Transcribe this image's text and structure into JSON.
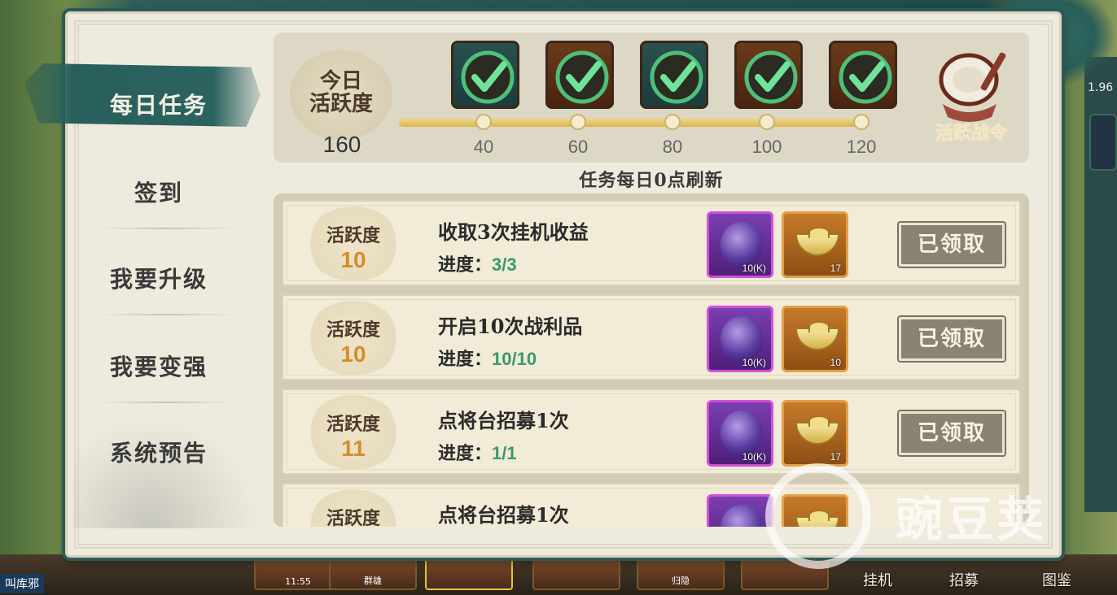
{
  "nav": {
    "items": [
      {
        "label": "每日任务",
        "active": true
      },
      {
        "label": "签到",
        "active": false
      },
      {
        "label": "我要升级",
        "active": false
      },
      {
        "label": "我要变强",
        "active": false
      },
      {
        "label": "系统预告",
        "active": false
      }
    ]
  },
  "activity": {
    "title": "今日活跃度",
    "value": "160",
    "progress_fraction": 1.0,
    "milestones": [
      "40",
      "60",
      "80",
      "100",
      "120"
    ],
    "chests": [
      {
        "style": "teal",
        "claimed": true
      },
      {
        "style": "brown",
        "claimed": true
      },
      {
        "style": "teal",
        "claimed": true
      },
      {
        "style": "brown",
        "claimed": true
      },
      {
        "style": "brown",
        "claimed": true
      }
    ],
    "token_label": "活跃战令"
  },
  "refresh_note": "任务每日0点刷新",
  "tasks": [
    {
      "badge_label": "活跃度",
      "points": "10",
      "name": "收取3次挂机收益",
      "progress_label": "进度：",
      "progress": "3/3",
      "rewards": [
        {
          "type": "purple-orb",
          "qty": "10(K)"
        },
        {
          "type": "gold-ingot",
          "qty": "17"
        }
      ],
      "button": "已领取"
    },
    {
      "badge_label": "活跃度",
      "points": "10",
      "name": "开启10次战利品",
      "progress_label": "进度：",
      "progress": "10/10",
      "rewards": [
        {
          "type": "purple-orb",
          "qty": "10(K)"
        },
        {
          "type": "gold-ingot",
          "qty": "10"
        }
      ],
      "button": "已领取"
    },
    {
      "badge_label": "活跃度",
      "points": "11",
      "name": "点将台招募1次",
      "progress_label": "进度：",
      "progress": "1/1",
      "rewards": [
        {
          "type": "purple-orb",
          "qty": "10(K)"
        },
        {
          "type": "gold-ingot",
          "qty": "17"
        }
      ],
      "button": "已领取"
    },
    {
      "badge_label": "活跃度",
      "points": "",
      "name": "点将台招募1次",
      "progress_label": "",
      "progress": "",
      "rewards": [
        {
          "type": "purple-orb",
          "qty": ""
        },
        {
          "type": "gold-ingot",
          "qty": ""
        }
      ],
      "button": ""
    }
  ],
  "background": {
    "bottom_cards": [
      "11:55",
      "群雄",
      "",
      "",
      "归隐",
      ""
    ],
    "right_labels": [
      "挂机",
      "招募",
      "图鉴"
    ],
    "left_label": "叫库邪",
    "right_side_text": [
      "1.96"
    ]
  },
  "watermark": "豌豆荚",
  "colors": {
    "accent_teal": "#2b6360",
    "claimed_gray": "#8a8272",
    "points_orange": "#d38e2a",
    "progress_green": "#3a9a6a"
  }
}
